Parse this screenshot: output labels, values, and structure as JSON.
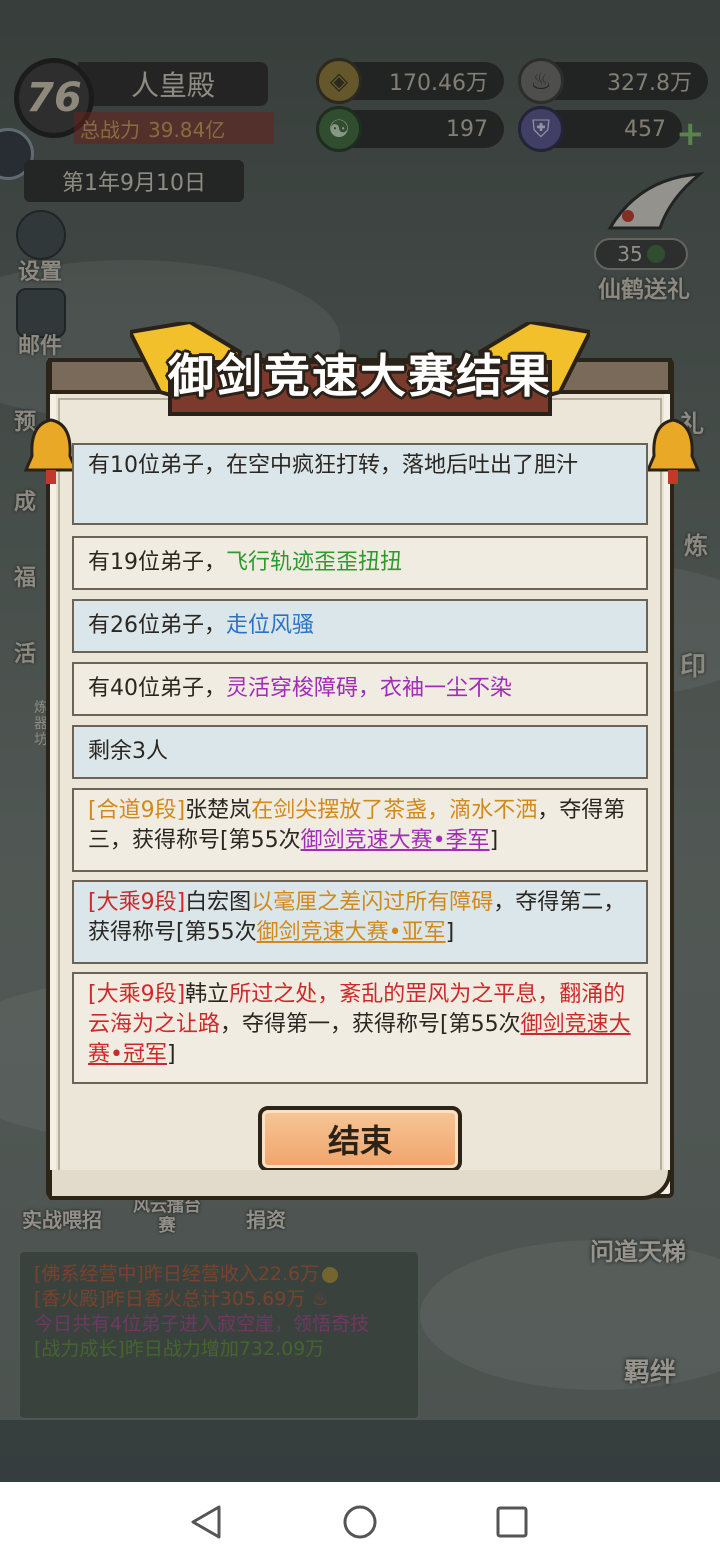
{
  "hud": {
    "level": "76",
    "hall_name": "人皇殿",
    "power_label": "总战力",
    "power_value": "39.84亿",
    "date": "第1年9月10日",
    "gold": "170.46万",
    "incense": "327.8万",
    "jade": "197",
    "shield": "457"
  },
  "left_menu": {
    "settings": "设置",
    "mail": "邮件",
    "yu": "预",
    "cheng": "成",
    "fu": "福",
    "huo": "活",
    "refine_1": "炼",
    "refine_2": "器",
    "refine_3": "坊"
  },
  "right_menu": {
    "crane_gift": "仙鹤送礼",
    "crane_count": "35",
    "li": "礼",
    "lian": "炼",
    "yin": "印",
    "wendao": "问道天梯",
    "jiban": "羁绊"
  },
  "bottom_labels": {
    "shizhan": "实战喂招",
    "fengyun": "风云擂台赛",
    "juanzi": "捐资"
  },
  "news": {
    "line1": "[佛系经营中]昨日经营收入22.6万",
    "line2": "[香火殿]昨日香火总计305.69万",
    "line3": "今日共有4位弟子进入寂空崖，领悟奇技",
    "line4": "[战力成长]昨日战力增加732.09万"
  },
  "modal": {
    "title": "御剑竞速大赛结果",
    "r1_text": "有10位弟子，在空中疯狂打转，落地后吐出了胆汁",
    "r2_prefix": "有19位弟子，",
    "r2_colored": "飞行轨迹歪歪扭扭",
    "r3_prefix": "有26位弟子，",
    "r3_colored": "走位风骚",
    "r4_prefix": "有40位弟子，",
    "r4_colored": "灵活穿梭障碍，衣袖一尘不染",
    "r5_text": "剩余3人",
    "r6_rank": "[合道9段]",
    "r6_name": "张楚岚",
    "r6_feat": "在剑尖摆放了茶盏，滴水不洒",
    "r6_mid": "，夺得第三，获得称号[第55次",
    "r6_title": "御剑竞速大赛•季军",
    "r6_end": "]",
    "r7_rank": "[大乘9段]",
    "r7_name": "白宏图",
    "r7_feat": "以毫厘之差闪过所有障碍",
    "r7_mid": "，夺得第二，获得称号[第55次",
    "r7_title": "御剑竞速大赛•亚军",
    "r7_end": "]",
    "r8_rank": "[大乘9段]",
    "r8_name": "韩立",
    "r8_feat": "所过之处，紊乱的罡风为之平息，翻涌的云海为之让路",
    "r8_mid": "，夺得第一，获得称号[第55次",
    "r8_title": "御剑竞速大赛•冠军",
    "r8_end": "]",
    "end_button": "结束"
  },
  "colors": {
    "green": "#2e9a2e",
    "blue": "#2a72c4",
    "purple": "#a02cb8",
    "orange": "#d18a1a",
    "red": "#cc2a2a",
    "button": "#f0a46a"
  }
}
